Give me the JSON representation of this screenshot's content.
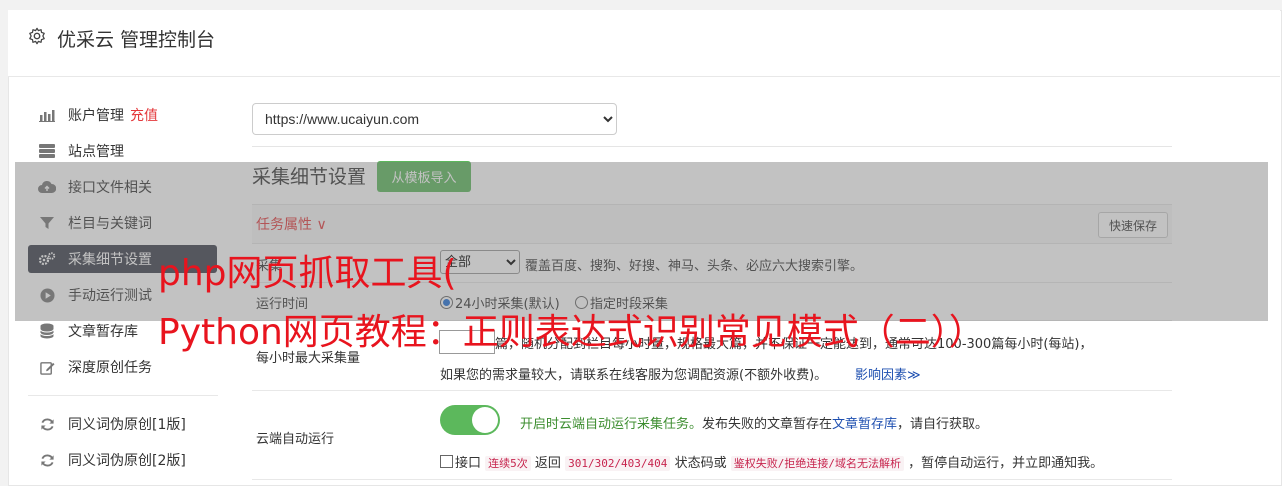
{
  "header": {
    "title": "优采云 管理控制台"
  },
  "sidebar": {
    "items": [
      {
        "label": "账户管理",
        "badge": "充值"
      },
      {
        "label": "站点管理"
      },
      {
        "label": "接口文件相关"
      },
      {
        "label": "栏目与关键词"
      },
      {
        "label": "采集细节设置"
      },
      {
        "label": "手动运行测试"
      },
      {
        "label": "文章暂存库"
      },
      {
        "label": "深度原创任务"
      },
      {
        "label": "同义词伪原创[1版]"
      },
      {
        "label": "同义词伪原创[2版]"
      }
    ]
  },
  "site_select": {
    "value": "https://www.ucaiyun.com"
  },
  "section": {
    "title": "采集细节设置",
    "import_button": "从模板导入"
  },
  "tabbar": {
    "task_attr": "任务属性 ∨",
    "quick_save": "快速保存"
  },
  "rows": {
    "engine": {
      "label": "采集",
      "select_value": "全部",
      "desc": "覆盖百度、搜狗、好搜、神马、头条、必应六大搜索引擎。"
    },
    "run_time": {
      "label": "运行时间",
      "opt1": "24小时采集(默认)",
      "opt2": "指定时段采集"
    },
    "max_per_hour": {
      "label": "每小时最大采集量",
      "unit": "篇",
      "desc_line1": "篇，随机分配到栏目每小时量，规格最大篇，并不保证一定能达到，通常可达100-300篇每小时(每站)，",
      "desc_line2": "如果您的需求量较大，请联系在线客服为您调配资源(不额外收费)。",
      "link": "影响因素≫"
    },
    "cloud": {
      "label": "云端自动运行",
      "desc_green": "开启时云端自动运行采集任务。",
      "desc_mid": "发布失败的文章暂存在",
      "desc_link": "文章暂存库",
      "desc_end": "，请自行获取。",
      "chk_label": "接口",
      "code1": "连续5次",
      "txt_back": "返回",
      "code2": "301/302/403/404",
      "txt_status": "状态码或",
      "code3": "鉴权失败/拒绝连接/域名无法解析",
      "txt_final": "，暂停自动运行，并立即通知我。"
    }
  },
  "watermark": {
    "line1": "php网页抓取工具(",
    "line2": "Python网页教程：正则表达式识别常见模式（二））"
  }
}
